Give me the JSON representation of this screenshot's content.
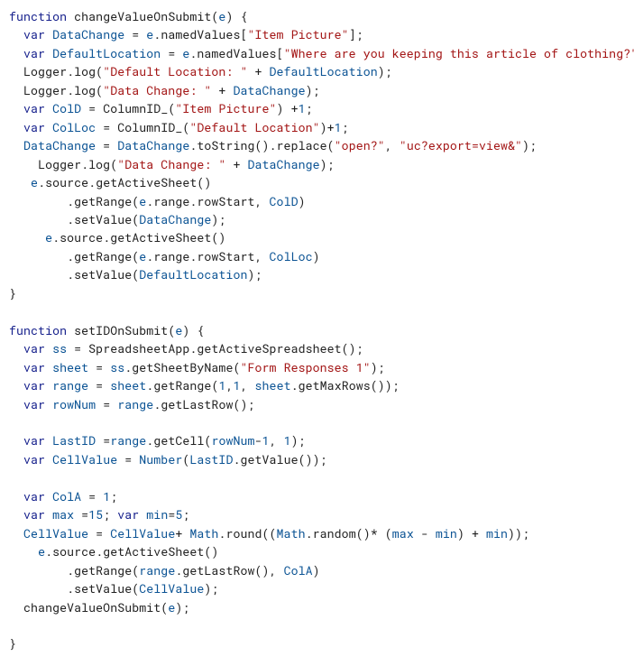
{
  "code": {
    "func1_name": "changeValueOnSubmit",
    "func2_name": "setIDOnSubmit",
    "str_item_picture": "\"Item Picture\"",
    "str_keeping": "\"Where are you keeping this article of clothing?\"",
    "str_default_loc_label": "\"Default Location: \"",
    "str_data_change_label": "\"Data Change: \"",
    "str_default_location": "\"Default Location\"",
    "str_open": "\"open?\"",
    "str_ucexport": "\"uc?export=view&\"",
    "str_form_responses": "\"Form Responses 1\"",
    "num_one_a": "1",
    "num_one_b": "1",
    "num_one_c": "1",
    "num_one_d": "1",
    "num_one_e": "1",
    "num_one_f": "1",
    "num_one_g": "1",
    "num_max": "15",
    "num_min": "5",
    "ids": {
      "DataChange": "DataChange",
      "DefaultLocation": "DefaultLocation",
      "ColD": "ColD",
      "ColLoc": "ColLoc",
      "ss": "ss",
      "sheet": "sheet",
      "range": "range",
      "rowNum": "rowNum",
      "LastID": "LastID",
      "CellValue": "CellValue",
      "ColA": "ColA",
      "max": "max",
      "min": "min",
      "e": "e",
      "Number_": "Number",
      "Math_": "Math"
    },
    "kw": {
      "function": "function",
      "var": "var"
    },
    "calls": {
      "namedValues": "namedValues",
      "Logger_log": "Logger.log",
      "ColumnID_": "ColumnID_",
      "toString": "toString",
      "replace": "replace",
      "source": "source",
      "getActiveSheet": "getActiveSheet",
      "getRange": "getRange",
      "rowStart": "rowStart",
      "setValue": "setValue",
      "SpreadsheetApp": "SpreadsheetApp",
      "getActiveSpreadsheet": "getActiveSpreadsheet",
      "getSheetByName": "getSheetByName",
      "getRange4": "getRange",
      "getMaxRows": "getMaxRows",
      "getLastRow": "getLastRow",
      "getCell": "getCell",
      "getValue": "getValue",
      "round": "round",
      "random": "random",
      "changeValueOnSubmit_call": "changeValueOnSubmit"
    }
  }
}
